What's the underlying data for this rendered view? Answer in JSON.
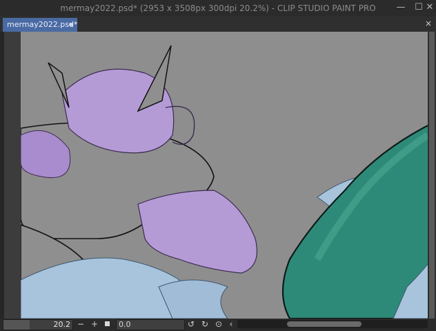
{
  "window": {
    "title": "mermay2022.psd* (2953 x 3508px 300dpi 20.2%)  - CLIP STUDIO PAINT PRO",
    "minimize": "—",
    "maximize": "☐",
    "close": "✕"
  },
  "tabs": [
    {
      "label": "mermay2022.psd*",
      "active": true,
      "modified": true
    }
  ],
  "tab_close": "×",
  "canvas": {
    "background": "#8e8e8e",
    "hair_color": "#b59bd6",
    "tail_color": "#2e8a78",
    "fin_color": "#a8c4dc"
  },
  "statusbar": {
    "zoom": "20.2",
    "zoom_minus": "−",
    "zoom_plus": "+",
    "angle": "0.0",
    "rotate_left": "↺",
    "rotate_right": "↻",
    "reset": "⊙",
    "scroll_left": "‹"
  }
}
